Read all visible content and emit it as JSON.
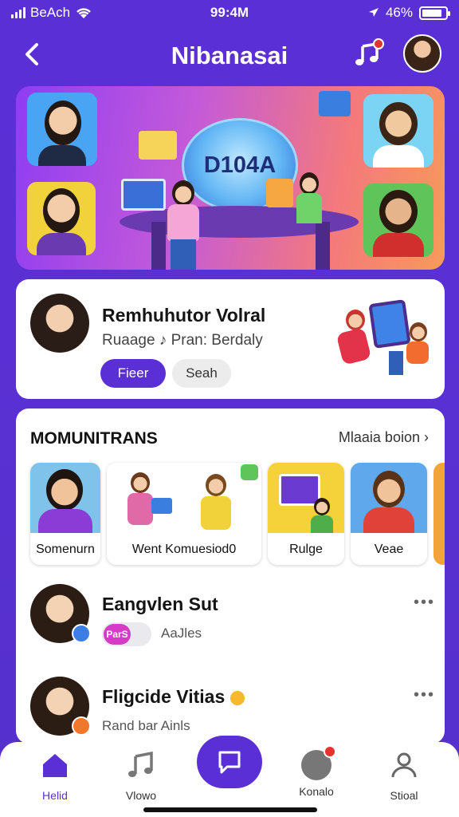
{
  "status_bar": {
    "carrier": "BeAch",
    "time": "99:4M",
    "battery": "46%"
  },
  "header": {
    "title": "Nibanasai"
  },
  "hero": {
    "globe_text": "D104A"
  },
  "profile": {
    "name": "Remhuhutor Volral",
    "subtitle": "Ruaage ♪ Pran: Berdaly",
    "primary_button": "Fieer",
    "secondary_button": "Seah"
  },
  "community": {
    "title": "MOMUNITRANS",
    "link": "Mlaaia boion",
    "thumbs": [
      {
        "label": "Somenurn"
      },
      {
        "label": "Went Komuesiod0"
      },
      {
        "label": "Rulge"
      },
      {
        "label": "Veae"
      }
    ]
  },
  "chats": [
    {
      "name": "Eangvlen Sut",
      "sub": "AaJles",
      "tag": "ParS"
    },
    {
      "name": "Fligcide Vitias",
      "sub": "Rand bar Ainls"
    }
  ],
  "nav": [
    {
      "label": "Helid"
    },
    {
      "label": "Vlowo"
    },
    {
      "label": "Konalo"
    },
    {
      "label": "Stioal"
    }
  ],
  "colors": {
    "accent": "#5b2fd6",
    "badge_red": "#e8322f",
    "background": "#5a30d4"
  }
}
